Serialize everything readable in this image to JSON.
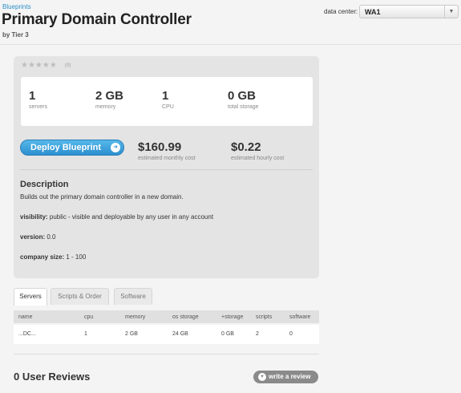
{
  "header": {
    "breadcrumb": "Blueprints",
    "title": "Primary Domain Controller",
    "byline": "by Tier 3",
    "data_center_label": "data center:",
    "data_center_value": "WA1"
  },
  "rating": {
    "stars": "★★★★★",
    "count": "(0)"
  },
  "stats": [
    {
      "value": "1",
      "label": "servers"
    },
    {
      "value": "2 GB",
      "label": "memory"
    },
    {
      "value": "1",
      "label": "CPU"
    },
    {
      "value": "0 GB",
      "label": "total storage"
    }
  ],
  "deploy": {
    "button_label": "Deploy Blueprint",
    "monthly_cost": "$160.99",
    "monthly_label": "estimated monthly cost",
    "hourly_cost": "$0.22",
    "hourly_label": "estimated hourly cost"
  },
  "description": {
    "heading": "Description",
    "text": "Builds out the primary domain controller in a new domain.",
    "visibility_label": "visibility:",
    "visibility_value": " public - visible and deployable by any user in any account",
    "version_label": "version:",
    "version_value": " 0.0",
    "company_size_label": "company size:",
    "company_size_value": " 1 - 100"
  },
  "tabs": [
    "Servers",
    "Scripts & Order",
    "Software"
  ],
  "table": {
    "columns": [
      "name",
      "cpu",
      "memory",
      "os storage",
      "+storage",
      "scripts",
      "software"
    ],
    "rows": [
      [
        "...DC...",
        "1",
        "2 GB",
        "24 GB",
        "0 GB",
        "2",
        "0"
      ]
    ]
  },
  "reviews": {
    "title": "0 User Reviews",
    "button_label": "write a review"
  }
}
